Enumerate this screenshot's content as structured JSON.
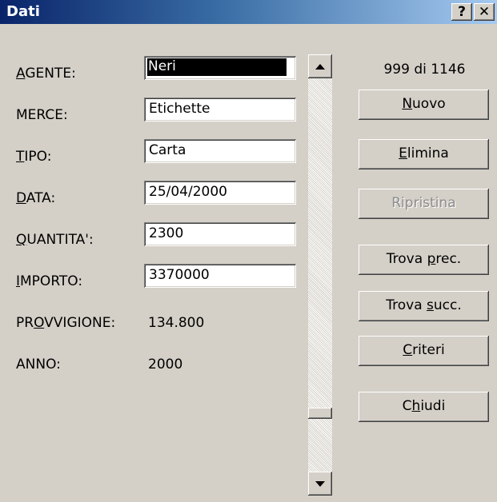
{
  "window": {
    "title": "Dati",
    "help_glyph": "?",
    "close_glyph": "✕"
  },
  "fields": [
    {
      "label_hot": "A",
      "label_rest": "GENTE:",
      "value": "Neri"
    },
    {
      "label_pre": "MERCE:",
      "value": "Etichette"
    },
    {
      "label_hot": "T",
      "label_rest": "IPO:",
      "value": "Carta"
    },
    {
      "label_hot": "D",
      "label_rest": "ATA:",
      "value": "25/04/2000"
    },
    {
      "label_hot": "Q",
      "label_rest": "UANTITA':",
      "value": "2300"
    },
    {
      "label_hot": "I",
      "label_rest": "MPORTO:",
      "value": "3370000"
    }
  ],
  "computed": [
    {
      "label_pre": "PR",
      "label_hot": "O",
      "label_rest": "VVIGIONE:",
      "value": "134.800"
    },
    {
      "label_pre": "ANNO:",
      "value": "2000"
    }
  ],
  "record_counter": "999 di 1146",
  "buttons": {
    "nuovo": {
      "hot": "N",
      "rest": "uovo"
    },
    "elimina": {
      "hot": "E",
      "rest": "limina"
    },
    "ripristina": {
      "pre": "Ripristina"
    },
    "trova_prec": {
      "pre": "Trova ",
      "hot": "p",
      "rest": "rec."
    },
    "trova_succ": {
      "pre": "Trova ",
      "hot": "s",
      "rest": "ucc."
    },
    "criteri": {
      "hot": "C",
      "rest": "riteri"
    },
    "chiudi": {
      "pre": "C",
      "hot": "h",
      "rest": "iudi"
    }
  },
  "scrollbar": {
    "up_glyph": "▲",
    "down_glyph": "▼",
    "position_fraction": 0.872
  },
  "colors": {
    "titlebar_start": "#0a246a",
    "titlebar_end": "#a6caf0",
    "face": "#d4d0c8"
  }
}
